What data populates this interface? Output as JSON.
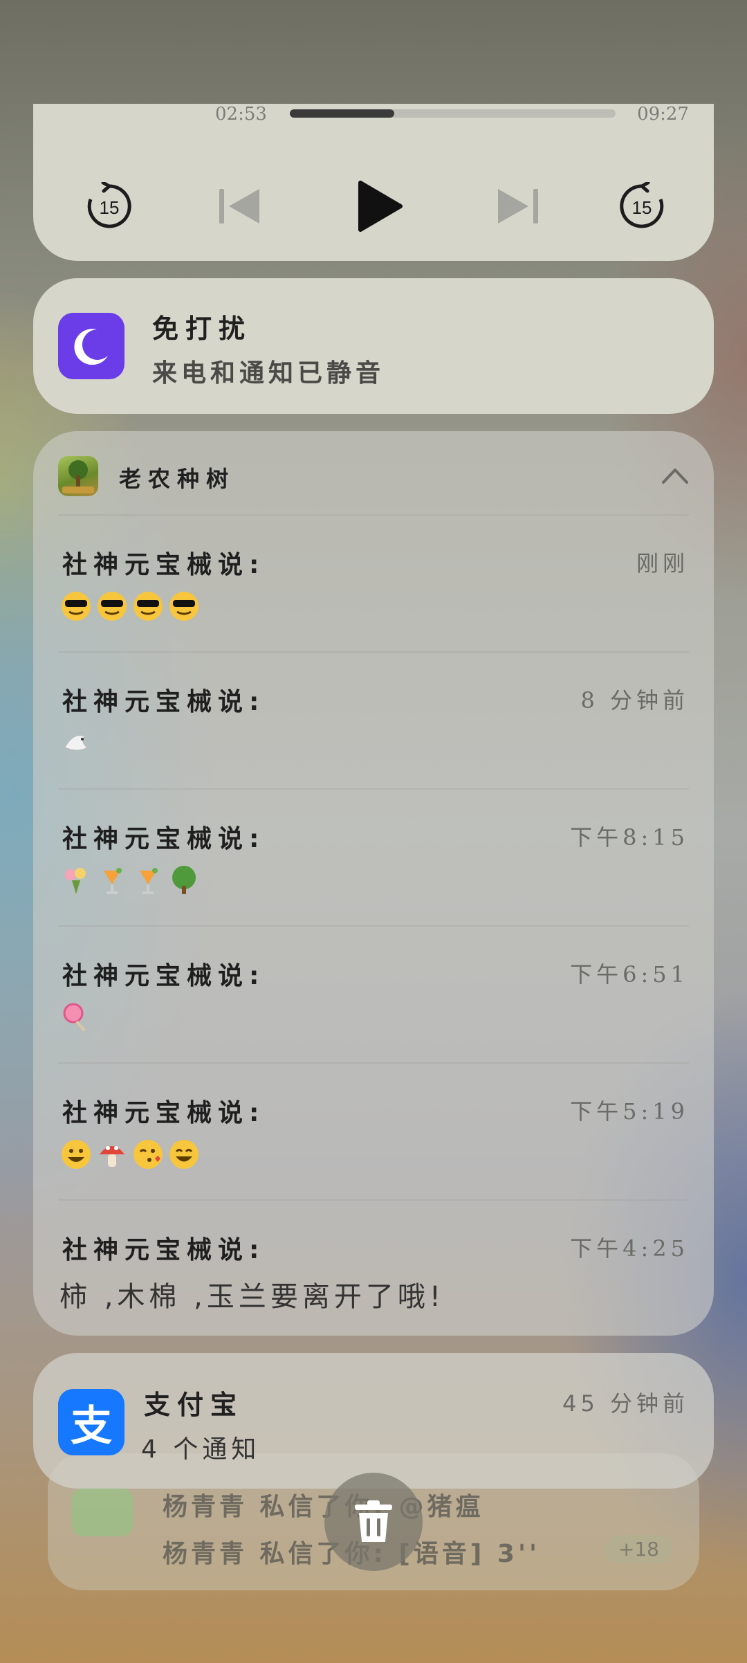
{
  "media": {
    "elapsed": "02:53",
    "duration": "09:27",
    "progress": 0.32
  },
  "dnd": {
    "title": "免打扰",
    "subtitle": "来电和通知已静音",
    "accent": "#6a3de8"
  },
  "app_group": {
    "app_name": "老农种树",
    "messages": [
      {
        "sender": "社神元宝械说:",
        "time": "刚刚",
        "text": "",
        "emojis": [
          "sunglasses-face",
          "sunglasses-face",
          "sunglasses-face",
          "sunglasses-face"
        ]
      },
      {
        "sender": "社神元宝械说:",
        "time": "8 分钟前",
        "text": "",
        "emojis": [
          "dove"
        ]
      },
      {
        "sender": "社神元宝械说:",
        "time": "下午8:15",
        "text": "",
        "emojis": [
          "flower-bouquet",
          "tropical-drink",
          "tropical-drink",
          "tree"
        ]
      },
      {
        "sender": "社神元宝械说:",
        "time": "下午6:51",
        "text": "",
        "emojis": [
          "lollipop"
        ]
      },
      {
        "sender": "社神元宝械说:",
        "time": "下午5:19",
        "text": "",
        "emojis": [
          "grinning-face",
          "mushroom",
          "kissing-face",
          "smiling-face"
        ]
      },
      {
        "sender": "社神元宝械说:",
        "time": "下午4:25",
        "text": "柿 ,木棉 ,玉兰要离开了哦!",
        "emojis": []
      }
    ]
  },
  "alipay": {
    "app_name": "支付宝",
    "time": "45 分钟前",
    "summary": "4 个通知",
    "icon_glyph": "支",
    "accent": "#1677ff"
  },
  "stacked": {
    "line1": "杨青青  私信了你: @猪瘟",
    "line2": "杨青青  私信了你: [语音] 3''",
    "count": "+18"
  }
}
